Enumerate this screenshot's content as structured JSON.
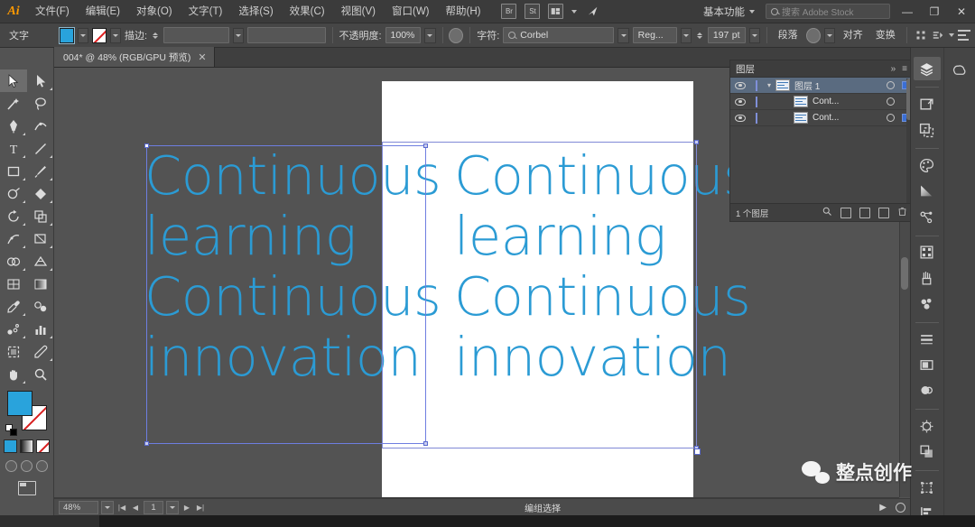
{
  "app": {
    "logo": "Ai",
    "menus": [
      "文件(F)",
      "编辑(E)",
      "对象(O)",
      "文字(T)",
      "选择(S)",
      "效果(C)",
      "视图(V)",
      "窗口(W)",
      "帮助(H)"
    ],
    "workspace": "基本功能",
    "stock_placeholder": "搜索 Adobe Stock",
    "icons": {
      "bridge": "Br",
      "stock": "St",
      "arrange": "arrange-icon",
      "arrange_caret": "chevron-down-icon",
      "sync": "sync-icon",
      "workspace_caret": "chevron-down-icon",
      "search": "search-icon",
      "minimize": "minimize-icon",
      "restore": "restore-icon",
      "close": "close-icon"
    },
    "window_buttons": {
      "minimize": "—",
      "restore": "❐",
      "close": "✕"
    }
  },
  "control_bar": {
    "tool_name": "文字",
    "fill_color": "#29a3dc",
    "stroke_color": "none",
    "stroke_label": "描边:",
    "stroke_weight": "",
    "brush_value": "",
    "opacity_label": "不透明度:",
    "opacity_value": "100%",
    "char_label": "字符:",
    "font_family": "Corbel",
    "font_style": "Reg...",
    "font_size": "197",
    "font_size_unit": "pt",
    "paragraph_label": "段落",
    "align_label": "对齐",
    "transform_label": "变换"
  },
  "document_tab": {
    "title": "004* @ 48% (RGB/GPU 预览)",
    "close": "✕"
  },
  "toolbar": {
    "tools": [
      {
        "name": "selection-tool",
        "active": true
      },
      {
        "name": "direct-selection-tool",
        "active": false
      },
      {
        "name": "magic-wand-tool",
        "active": false
      },
      {
        "name": "lasso-tool",
        "active": false
      },
      {
        "name": "pen-tool",
        "active": false
      },
      {
        "name": "curvature-tool",
        "active": false
      },
      {
        "name": "type-tool",
        "active": false
      },
      {
        "name": "line-segment-tool",
        "active": false
      },
      {
        "name": "rectangle-tool",
        "active": false
      },
      {
        "name": "paintbrush-tool",
        "active": false
      },
      {
        "name": "shaper-tool",
        "active": false
      },
      {
        "name": "eraser-tool",
        "active": false
      },
      {
        "name": "rotate-tool",
        "active": false
      },
      {
        "name": "scale-tool",
        "active": false
      },
      {
        "name": "width-tool",
        "active": false
      },
      {
        "name": "free-transform-tool",
        "active": false
      },
      {
        "name": "shape-builder-tool",
        "active": false
      },
      {
        "name": "perspective-grid-tool",
        "active": false
      },
      {
        "name": "mesh-tool",
        "active": false
      },
      {
        "name": "gradient-tool",
        "active": false
      },
      {
        "name": "eyedropper-tool",
        "active": false
      },
      {
        "name": "blend-tool",
        "active": false
      },
      {
        "name": "symbol-sprayer-tool",
        "active": false
      },
      {
        "name": "column-graph-tool",
        "active": false
      },
      {
        "name": "artboard-tool",
        "active": false
      },
      {
        "name": "slice-tool",
        "active": false
      },
      {
        "name": "hand-tool",
        "active": false
      },
      {
        "name": "zoom-tool",
        "active": false
      }
    ],
    "fill_color": "#29a3dc",
    "stroke_color": "none",
    "color_modes": [
      "color-fill",
      "gradient-fill",
      "none-fill"
    ],
    "screen_modes": [
      "normal-screen-mode",
      "full-screen-menubar",
      "full-screen"
    ]
  },
  "canvas": {
    "artboard_text_lines": [
      "Continuous",
      " learning",
      "Continuous",
      "innovation"
    ],
    "offboard_text_lines": [
      "Continuous",
      " learning",
      "Continuous",
      "innovation"
    ],
    "text_color": "#2b9bd4",
    "selection_border_color": "#6e7ee0"
  },
  "layers_panel": {
    "title": "图层",
    "collapse_icon": "chevron-double-right-icon",
    "menu_icon": "panel-menu-icon",
    "rows": [
      {
        "name": "图层 1",
        "type": "layer",
        "selected": true,
        "visible": true,
        "locked": false,
        "expanded": true,
        "has_selection_square": true
      },
      {
        "name": "Cont...",
        "type": "sublayer",
        "selected": false,
        "visible": true,
        "locked": false,
        "expanded": false,
        "has_selection_square": false
      },
      {
        "name": "Cont...",
        "type": "sublayer",
        "selected": false,
        "visible": true,
        "locked": false,
        "expanded": false,
        "has_selection_square": true
      }
    ],
    "footer_count": "1 个图层",
    "footer_icons": [
      "locate-object-icon",
      "make-mask-icon",
      "create-sublayer-icon",
      "new-layer-icon",
      "delete-layer-icon"
    ]
  },
  "right_dock": {
    "column_one": [
      {
        "name": "layers-panel-icon",
        "active": true
      },
      {
        "name": "libraries-panel-icon",
        "active": false
      },
      {
        "name": "artboards-panel-icon",
        "active": false
      },
      {
        "name": "color-panel-icon",
        "active": false
      },
      {
        "name": "gradient-panel-icon",
        "active": false
      },
      {
        "name": "color-guide-panel-icon",
        "active": false
      },
      {
        "name": "swatches-panel-icon",
        "active": false
      },
      {
        "name": "brushes-panel-icon",
        "active": false
      },
      {
        "name": "symbols-panel-icon",
        "active": false
      },
      {
        "name": "stroke-panel-icon",
        "active": false
      },
      {
        "name": "appearance-panel-icon",
        "active": false
      },
      {
        "name": "graphic-styles-panel-icon",
        "active": false
      },
      {
        "name": "transparency-panel-icon",
        "active": false
      },
      {
        "name": "pathfinder-panel-icon",
        "active": false
      },
      {
        "name": "transform-panel-icon",
        "active": false
      },
      {
        "name": "align-panel-icon",
        "active": false
      }
    ],
    "column_two": [
      {
        "name": "libraries-cc-icon",
        "active": false
      }
    ]
  },
  "status_bar": {
    "zoom": "48%",
    "zoom_caret": "chevron-down-icon",
    "page_first": "|◀",
    "page_prev": "◀",
    "page_value": "1",
    "page_next": "▶",
    "page_last": "▶|",
    "status_text": "编组选择",
    "play_icon": "play-icon",
    "info_icon": "info-icon"
  },
  "watermark": {
    "icon": "wechat-icon",
    "text": "整点创作"
  }
}
